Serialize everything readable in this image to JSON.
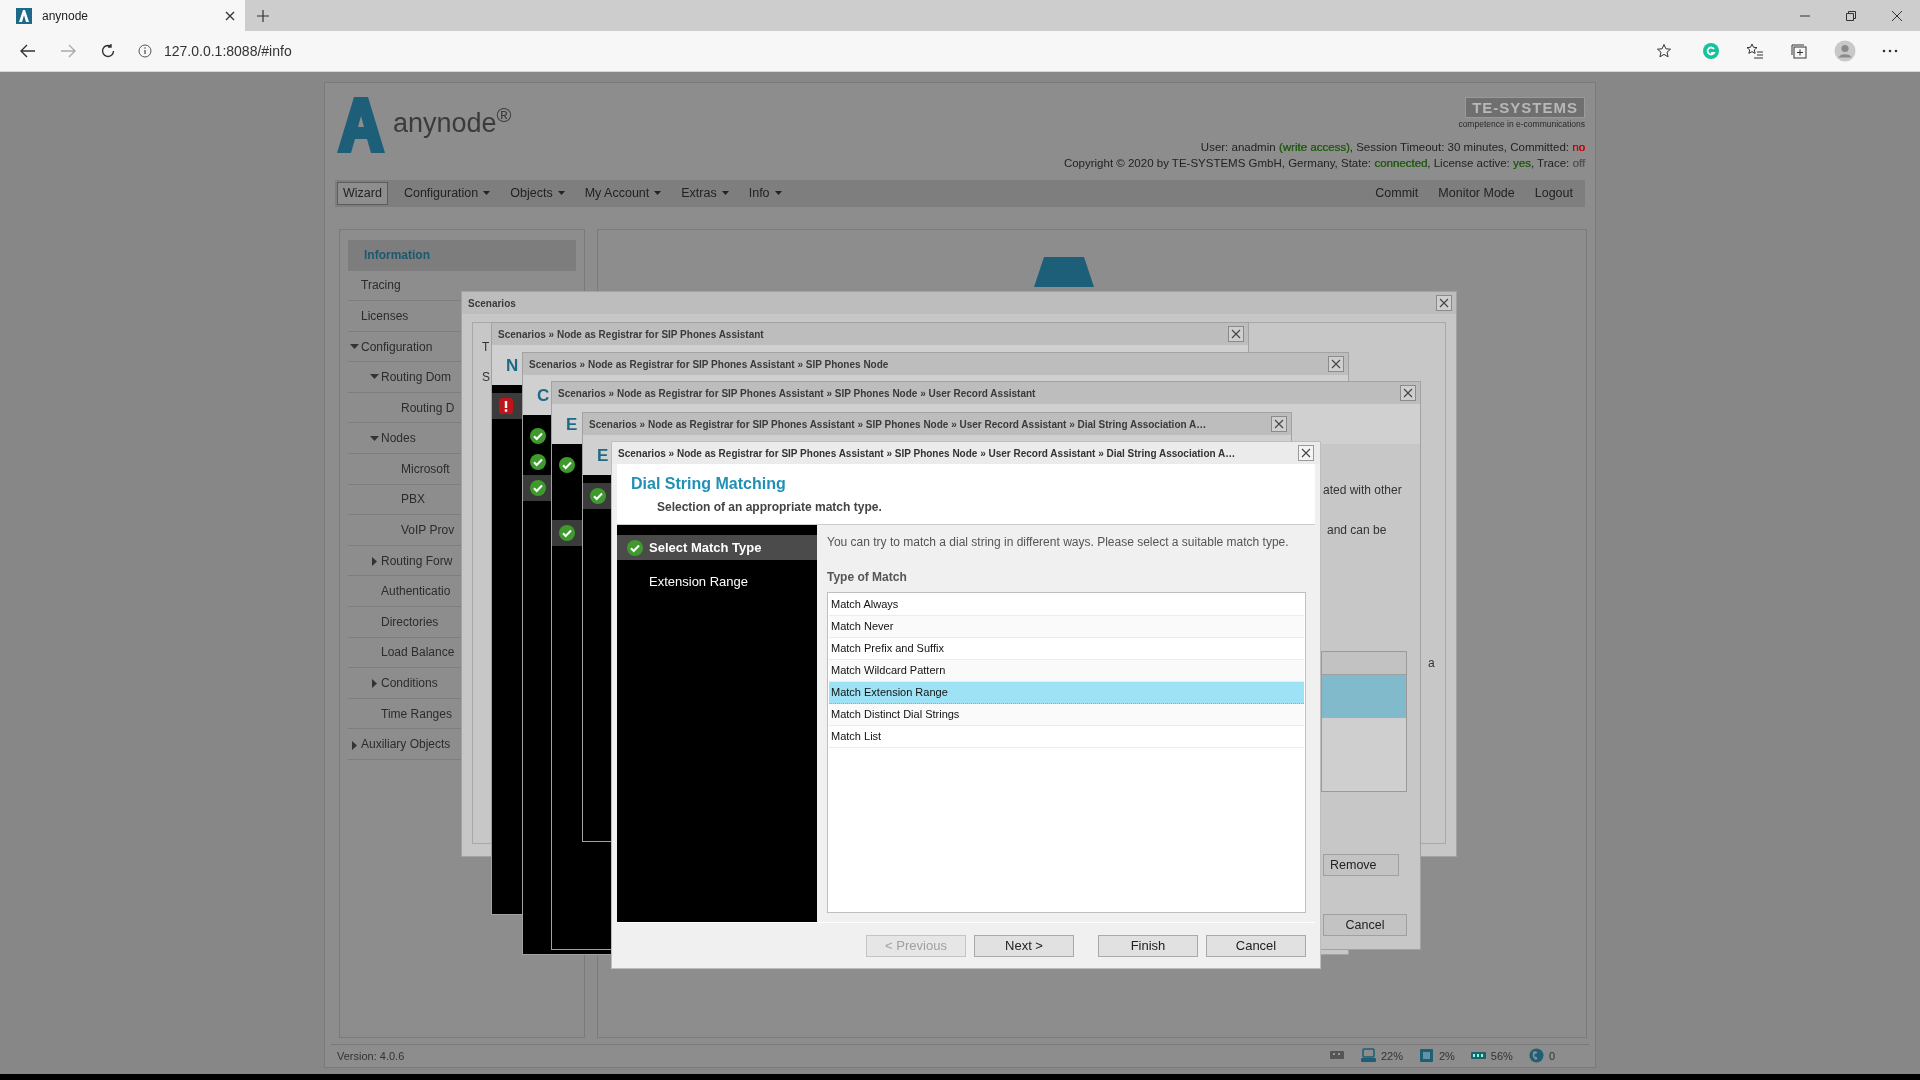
{
  "browser": {
    "tab_title": "anynode",
    "url": "127.0.0.1:8088/#info"
  },
  "header": {
    "brand": "anynode$^{®}$",
    "vendor": "TE-SYSTEMS",
    "vendor_tagline": "competence in e-communications",
    "status_lines": [
      [
        {
          "text": "User: anadmin "
        },
        {
          "text": "(write access)",
          "color": "#245c14"
        },
        {
          "text": ", Session Timeout: 30 minutes, Committed: "
        },
        {
          "text": "no",
          "color": "#cc0000"
        }
      ],
      [
        {
          "text": "Copyright © 2020 by TE-SYSTEMS GmbH, Germany, State: "
        },
        {
          "text": "connected",
          "color": "#245c14"
        },
        {
          "text": ", License active: "
        },
        {
          "text": "yes",
          "color": "#245c14"
        },
        {
          "text": ", Trace: "
        },
        {
          "text": "off",
          "color": "#555555"
        }
      ]
    ]
  },
  "menu": {
    "left": [
      {
        "label": "Wizard",
        "kind": "button"
      },
      {
        "label": "Configuration",
        "kind": "dropdown"
      },
      {
        "label": "Objects",
        "kind": "dropdown"
      },
      {
        "label": "My Account",
        "kind": "dropdown"
      },
      {
        "label": "Extras",
        "kind": "dropdown"
      },
      {
        "label": "Info",
        "kind": "dropdown"
      }
    ],
    "right": [
      {
        "label": "Commit"
      },
      {
        "label": "Monitor Mode"
      },
      {
        "label": "Logout"
      }
    ]
  },
  "sidebar": {
    "items": [
      {
        "label": "Information",
        "selected": true
      },
      {
        "label": "Tracing",
        "selected": false
      },
      {
        "label": "Licenses",
        "selected": false
      },
      {
        "label": "Configuration",
        "selected": false,
        "expanded": true,
        "children": [
          {
            "label": "Routing Dom",
            "selected": false,
            "expanded": true,
            "children": [
              {
                "label": "Routing D",
                "selected": false
              }
            ]
          },
          {
            "label": "Nodes",
            "selected": false,
            "expanded": true,
            "children": [
              {
                "label": "Microsoft",
                "selected": false
              },
              {
                "label": "PBX",
                "selected": false
              },
              {
                "label": "VoIP Prov",
                "selected": false
              }
            ]
          },
          {
            "label": "Routing Forw",
            "selected": false,
            "expanded": false
          },
          {
            "label": "Authenticatio",
            "selected": false
          },
          {
            "label": "Directories",
            "selected": false
          },
          {
            "label": "Load Balance",
            "selected": false
          },
          {
            "label": "Conditions",
            "selected": false,
            "expanded": false
          },
          {
            "label": "Time Ranges",
            "selected": false
          }
        ]
      },
      {
        "label": "Auxiliary Objects",
        "selected": false,
        "expanded": false
      }
    ]
  },
  "footer": {
    "version": "Version: 4.0.6",
    "stats": [
      {
        "kind": "network"
      },
      {
        "kind": "disk",
        "value": "22%"
      },
      {
        "kind": "cpu",
        "value": "2%"
      },
      {
        "kind": "memory",
        "value": "56%"
      },
      {
        "kind": "calls",
        "value": "0"
      }
    ]
  },
  "dialogs": [
    {
      "kind": "plain",
      "title": "Scenarios",
      "fragments": [
        "T",
        "S",
        "a"
      ]
    },
    {
      "kind": "wizard",
      "title": "Scenarios » Node as Registrar for SIP Phones Assistant",
      "heading": "N",
      "steps": [
        {
          "kind": "error",
          "selected": true
        }
      ]
    },
    {
      "kind": "wizard",
      "title": "Scenarios » Node as Registrar for SIP Phones Assistant » SIP Phones Node",
      "heading": "C",
      "steps": [
        {
          "kind": "done",
          "selected": false
        },
        {
          "kind": "done",
          "selected": false
        },
        {
          "kind": "done",
          "selected": true
        }
      ]
    },
    {
      "kind": "wizard",
      "title": "Scenarios » Node as Registrar for SIP Phones Assistant » SIP Phones Node » User Record Assistant",
      "heading": "E",
      "steps": [
        {
          "kind": "done",
          "selected": false
        },
        {
          "kind": "done",
          "selected": true
        }
      ],
      "fragments": [
        "ated with other",
        "and can be"
      ],
      "table": {
        "rows": [
          {
            "selected": true
          }
        ]
      },
      "list_button": "Remove",
      "footer_button": "Cancel"
    },
    {
      "kind": "wizard",
      "title": "Scenarios » Node as Registrar for SIP Phones Assistant » SIP Phones Node » User Record Assistant » Dial String Association A…",
      "heading": "E",
      "steps": [
        {
          "kind": "done",
          "selected": true
        }
      ]
    }
  ],
  "wizard": {
    "title": "Scenarios » Node as Registrar for SIP Phones Assistant » SIP Phones Node » User Record Assistant » Dial String Association A…",
    "heading": "Dial String Matching",
    "subheading": "Selection of an appropriate match type.",
    "steps": [
      {
        "label": "Select Match Type",
        "kind": "done",
        "selected": true
      },
      {
        "label": "Extension Range",
        "kind": "pending",
        "selected": false
      }
    ],
    "intro": "You can try to match a dial string in different ways. Please select a suitable match type.",
    "field_label": "Type of Match",
    "options": [
      {
        "label": "Match Always",
        "selected": false
      },
      {
        "label": "Match Never",
        "selected": false
      },
      {
        "label": "Match Prefix and Suffix",
        "selected": false
      },
      {
        "label": "Match Wildcard Pattern",
        "selected": false
      },
      {
        "label": "Match Extension Range",
        "selected": true
      },
      {
        "label": "Match Distinct Dial Strings",
        "selected": false
      },
      {
        "label": "Match List",
        "selected": false
      }
    ],
    "buttons": [
      {
        "label": "< Previous",
        "disabled": true
      },
      {
        "label": "Next >",
        "disabled": false
      },
      {
        "label": "Finish",
        "disabled": false
      },
      {
        "label": "Cancel",
        "disabled": false
      }
    ]
  }
}
